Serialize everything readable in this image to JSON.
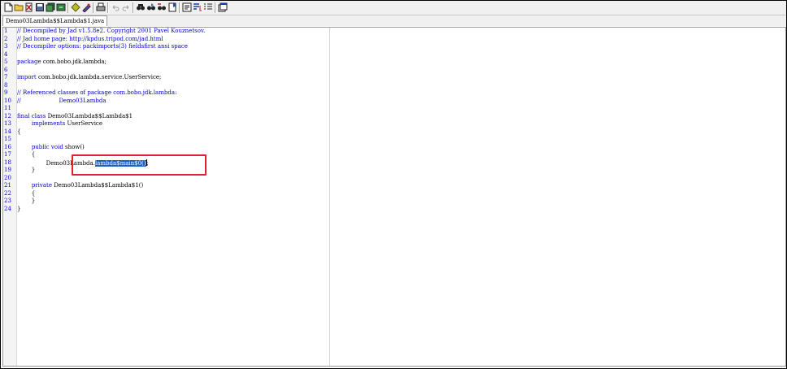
{
  "toolbar": {
    "icons": [
      "new-file-icon",
      "open-folder-icon",
      "close-file-icon",
      "save-icon",
      "save-all-icon",
      "reload-icon",
      "decompile-icon",
      "settings-icon",
      "print-icon",
      "undo-icon",
      "redo-icon",
      "find-icon",
      "find-next-icon",
      "replace-icon",
      "bookmark-icon",
      "format-icon",
      "word-wrap-icon",
      "list-icon",
      "window-icon"
    ]
  },
  "tab": {
    "label": "Demo03Lambda$$Lambda$1.java"
  },
  "editor": {
    "lines": [
      {
        "num": "1",
        "text": "// Decompiled by Jad v1.5.8e2. Copyright 2001 Pavel Kouznetsov."
      },
      {
        "num": "2",
        "text": "// Jad home page: http://kpdus.tripod.com/jad.html"
      },
      {
        "num": "3",
        "text": "// Decompiler options: packimports(3) fieldsfirst ansi space"
      },
      {
        "num": "4",
        "text": ""
      },
      {
        "num": "5",
        "kw": "package",
        "rest": " com.bobo.jdk.lambda;"
      },
      {
        "num": "6",
        "text": ""
      },
      {
        "num": "7",
        "kw": "import",
        "rest": " com.bobo.jdk.lambda.service.UserService;"
      },
      {
        "num": "8",
        "text": ""
      },
      {
        "num": "9",
        "text": "// Referenced classes of package com.bobo.jdk.lambda:"
      },
      {
        "num": "10",
        "text": "//                     Demo03Lambda"
      },
      {
        "num": "11",
        "text": ""
      },
      {
        "num": "12",
        "kw": "final class",
        "rest": " Demo03Lambda$$Lambda$1"
      },
      {
        "num": "13",
        "pre": "        ",
        "kw": "implements",
        "rest": " UserService"
      },
      {
        "num": "14",
        "rest": "{"
      },
      {
        "num": "15",
        "text": ""
      },
      {
        "num": "16",
        "pre": "        ",
        "kw": "public void",
        "rest": " show()"
      },
      {
        "num": "17",
        "rest": "        {"
      },
      {
        "num": "18",
        "pre": "                Demo03Lambda.",
        "sel": "lambda$main$0()",
        "post": ";"
      },
      {
        "num": "19",
        "rest": "        }"
      },
      {
        "num": "20",
        "text": ""
      },
      {
        "num": "21",
        "pre": "        ",
        "kw": "private",
        "rest": " Demo03Lambda$$Lambda$1()"
      },
      {
        "num": "22",
        "rest": "        {"
      },
      {
        "num": "23",
        "rest": "        }"
      },
      {
        "num": "24",
        "rest": "}"
      }
    ]
  },
  "colors": {
    "comment": "#0000cc",
    "keyword": "#0000cc",
    "selection": "#1662c4",
    "annotation_box": "#e0202a"
  }
}
